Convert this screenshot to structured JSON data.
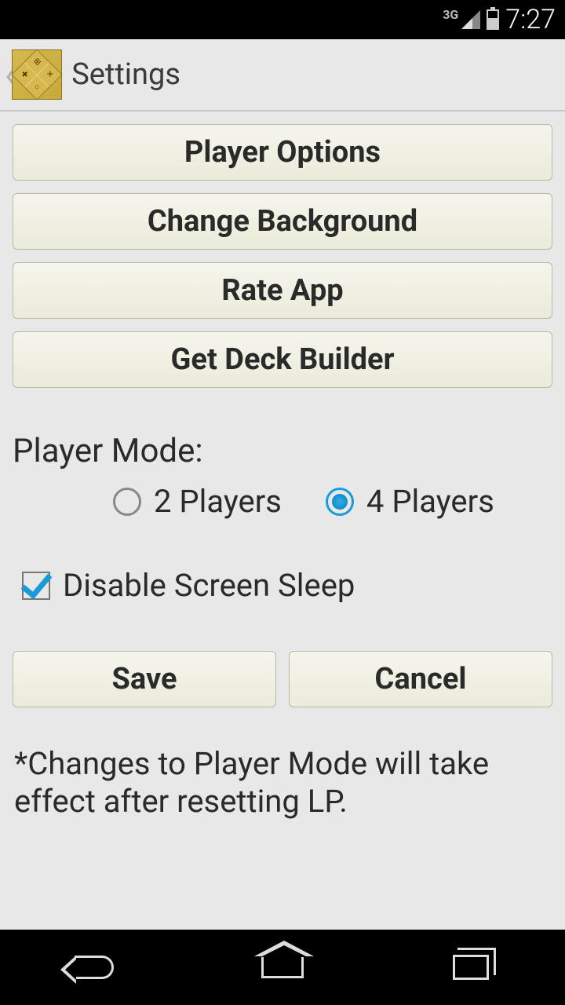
{
  "status": {
    "network": "3G",
    "time": "7:27"
  },
  "header": {
    "title": "Settings"
  },
  "buttons": {
    "player_options": "Player Options",
    "change_background": "Change Background",
    "rate_app": "Rate App",
    "get_deck_builder": "Get Deck Builder",
    "save": "Save",
    "cancel": "Cancel"
  },
  "player_mode": {
    "label": "Player Mode:",
    "option_2": "2 Players",
    "option_4": "4 Players",
    "selected": "4"
  },
  "checkbox": {
    "disable_sleep": "Disable Screen Sleep",
    "checked": true
  },
  "note": "*Changes to Player Mode will take effect after resetting LP."
}
